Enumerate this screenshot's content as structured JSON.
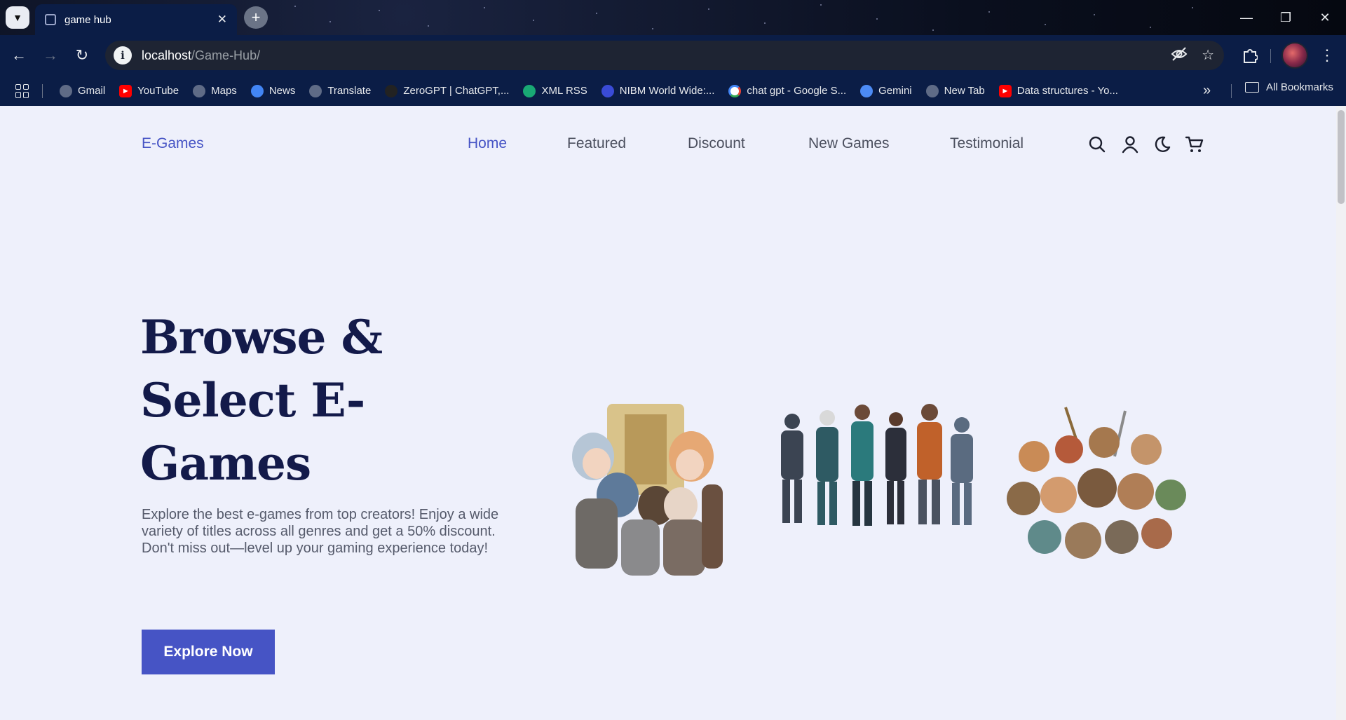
{
  "browser": {
    "tab_title": "game hub",
    "url_host": "localhost",
    "url_path": "/Game-Hub/",
    "bookmarks": [
      {
        "label": "Gmail",
        "icon": "globe-icon",
        "color": "#5f6b86"
      },
      {
        "label": "YouTube",
        "icon": "youtube-icon",
        "color": "#ff0000"
      },
      {
        "label": "Maps",
        "icon": "globe-icon",
        "color": "#5f6b86"
      },
      {
        "label": "News",
        "icon": "news-icon",
        "color": "#4285f4"
      },
      {
        "label": "Translate",
        "icon": "globe-icon",
        "color": "#5f6b86"
      },
      {
        "label": "ZeroGPT | ChatGPT,...",
        "icon": "zerogpt-icon",
        "color": "#222222"
      },
      {
        "label": "XML RSS",
        "icon": "w-icon",
        "color": "#19a974"
      },
      {
        "label": "NIBM World Wide:...",
        "icon": "nibm-icon",
        "color": "#3a4bd6"
      },
      {
        "label": "chat gpt - Google S...",
        "icon": "google-icon",
        "color": "#ffffff"
      },
      {
        "label": "Gemini",
        "icon": "gemini-icon",
        "color": "#4c8bf5"
      },
      {
        "label": "New Tab",
        "icon": "globe-icon",
        "color": "#5f6b86"
      },
      {
        "label": "Data structures - Yo...",
        "icon": "youtube-icon",
        "color": "#ff0000"
      }
    ],
    "all_bookmarks": "All Bookmarks"
  },
  "site": {
    "logo": "E-Games",
    "nav": [
      "Home",
      "Featured",
      "Discount",
      "New Games",
      "Testimonial"
    ],
    "active_nav": "Home",
    "accent": "#4654c5"
  },
  "hero": {
    "title_lines": [
      "Browse &",
      "Select E-",
      "Games"
    ],
    "description": "Explore the best e-games from top creators! Enjoy a wide variety of titles across all genres and get a 50% discount. Don't miss out—level up your gaming experience today!",
    "cta": "Explore Now"
  }
}
